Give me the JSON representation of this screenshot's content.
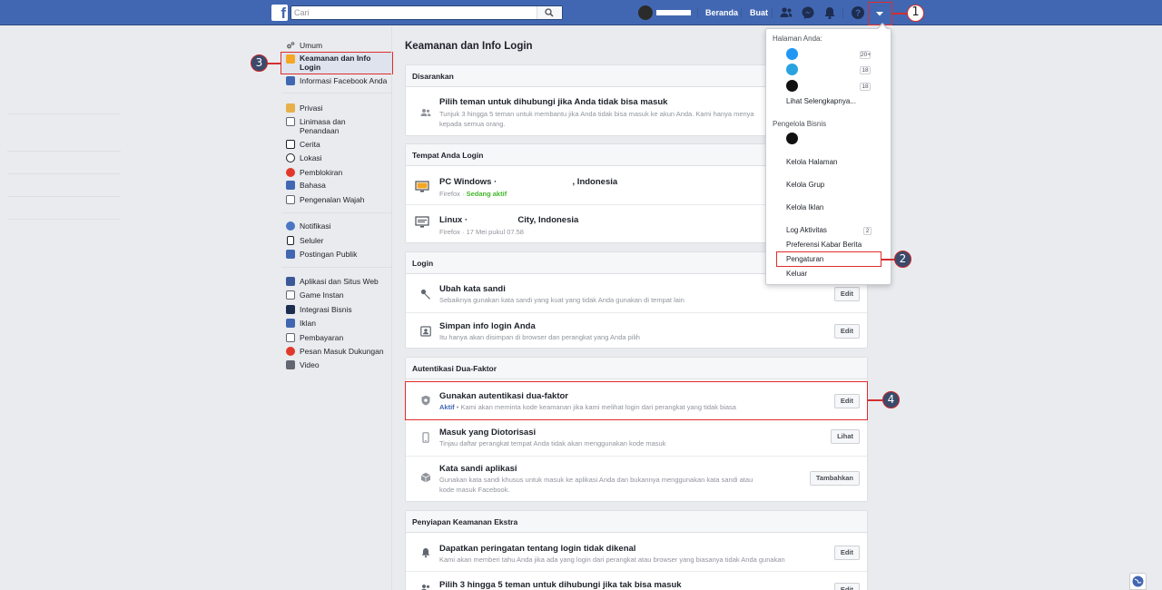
{
  "topbar": {
    "search_placeholder": "Cari",
    "nav": {
      "home": "Beranda",
      "create": "Buat"
    },
    "accent": "#4267b2"
  },
  "sidebar": {
    "group1": [
      {
        "label": "Umum",
        "icon": "gear-icon"
      },
      {
        "label": "Keamanan dan Info Login",
        "icon": "shield-icon",
        "active": true
      },
      {
        "label": "Informasi Facebook Anda",
        "icon": "facebook-icon"
      }
    ],
    "group2": [
      {
        "label": "Privasi",
        "icon": "lock-icon"
      },
      {
        "label": "Linimasa dan Penandaan",
        "icon": "timeline-icon"
      },
      {
        "label": "Cerita",
        "icon": "book-icon"
      },
      {
        "label": "Lokasi",
        "icon": "location-icon"
      },
      {
        "label": "Pemblokiran",
        "icon": "block-icon"
      },
      {
        "label": "Bahasa",
        "icon": "language-icon"
      },
      {
        "label": "Pengenalan Wajah",
        "icon": "face-icon"
      }
    ],
    "group3": [
      {
        "label": "Notifikasi",
        "icon": "globe-icon"
      },
      {
        "label": "Seluler",
        "icon": "mobile-icon"
      },
      {
        "label": "Postingan Publik",
        "icon": "rss-icon"
      }
    ],
    "group4": [
      {
        "label": "Aplikasi dan Situs Web",
        "icon": "apps-icon"
      },
      {
        "label": "Game Instan",
        "icon": "game-icon"
      },
      {
        "label": "Integrasi Bisnis",
        "icon": "business-icon"
      },
      {
        "label": "Iklan",
        "icon": "ads-icon"
      },
      {
        "label": "Pembayaran",
        "icon": "payment-icon"
      },
      {
        "label": "Pesan Masuk Dukungan",
        "icon": "support-icon"
      },
      {
        "label": "Video",
        "icon": "video-icon"
      }
    ]
  },
  "main": {
    "title": "Keamanan dan Info Login",
    "recommended": {
      "header": "Disarankan",
      "row_title": "Pilih teman untuk dihubungi jika Anda tidak bisa masuk",
      "row_sub_1": "Tunjuk 3 hingga 5 teman untuk membantu jika Anda tidak bisa masuk ke akun Anda. Kami hanya menya",
      "row_sub_2": "kepada semua orang."
    },
    "where_logged": {
      "header": "Tempat Anda Login",
      "windows_title": "PC Windows ·",
      "windows_loc": ", Indonesia",
      "windows_sub_browser": "Firefox · ",
      "windows_status": "Sedang aktif",
      "linux_title": "Linux ·",
      "linux_loc": "City, Indonesia",
      "linux_sub": "Firefox · 17 Mei pukul 07.58"
    },
    "login": {
      "header": "Login",
      "change_pw_title": "Ubah kata sandi",
      "change_pw_sub": "Sebaiknya gunakan kata sandi yang kuat yang tidak Anda gunakan di tempat lain",
      "save_login_title": "Simpan info login Anda",
      "save_login_sub": "Itu hanya akan disimpan di browser dan perangkat yang Anda pilih",
      "edit": "Edit"
    },
    "two_factor": {
      "header": "Autentikasi Dua-Faktor",
      "use_2fa_title": "Gunakan autentikasi dua-faktor",
      "use_2fa_status": "Aktif",
      "use_2fa_sub": " • Kami akan meminta kode keamanan jika kami melihat login dari perangkat yang tidak biasa",
      "authorized_title": "Masuk yang Diotorisasi",
      "authorized_sub": "Tinjau daftar perangkat tempat Anda tidak akan menggunakan kode masuk",
      "view": "Lihat",
      "app_pw_title": "Kata sandi aplikasi",
      "app_pw_sub_1": "Gunakan kata sandi khusus untuk masuk ke aplikasi Anda dan bukannya menggunakan kata sandi atau",
      "app_pw_sub_2": "kode masuk Facebook.",
      "add": "Tambahkan",
      "edit": "Edit"
    },
    "extra": {
      "header": "Penyiapan Keamanan Ekstra",
      "alerts_title": "Dapatkan peringatan tentang login tidak dikenal",
      "alerts_sub": "Kami akan memberi tahu Anda jika ada yang login dari perangkat atau browser yang biasanya tidak Anda gunakan",
      "friends_title": "Pilih 3 hingga 5 teman untuk dihubungi jika tak bisa masuk",
      "edit": "Edit"
    }
  },
  "dropdown": {
    "pages_header": "Halaman Anda:",
    "page_counts": [
      "20+",
      "18",
      "18"
    ],
    "see_more": "Lihat Selengkapnya...",
    "business_header": "Pengelola Bisnis",
    "manage_pages": "Kelola Halaman",
    "manage_groups": "Kelola Grup",
    "manage_ads": "Kelola Iklan",
    "activity_log": "Log Aktivitas",
    "activity_count": "2",
    "news_feed_prefs": "Preferensi Kabar Berita",
    "settings": "Pengaturan",
    "logout": "Keluar"
  },
  "annotations": [
    "1",
    "2",
    "3",
    "4"
  ]
}
